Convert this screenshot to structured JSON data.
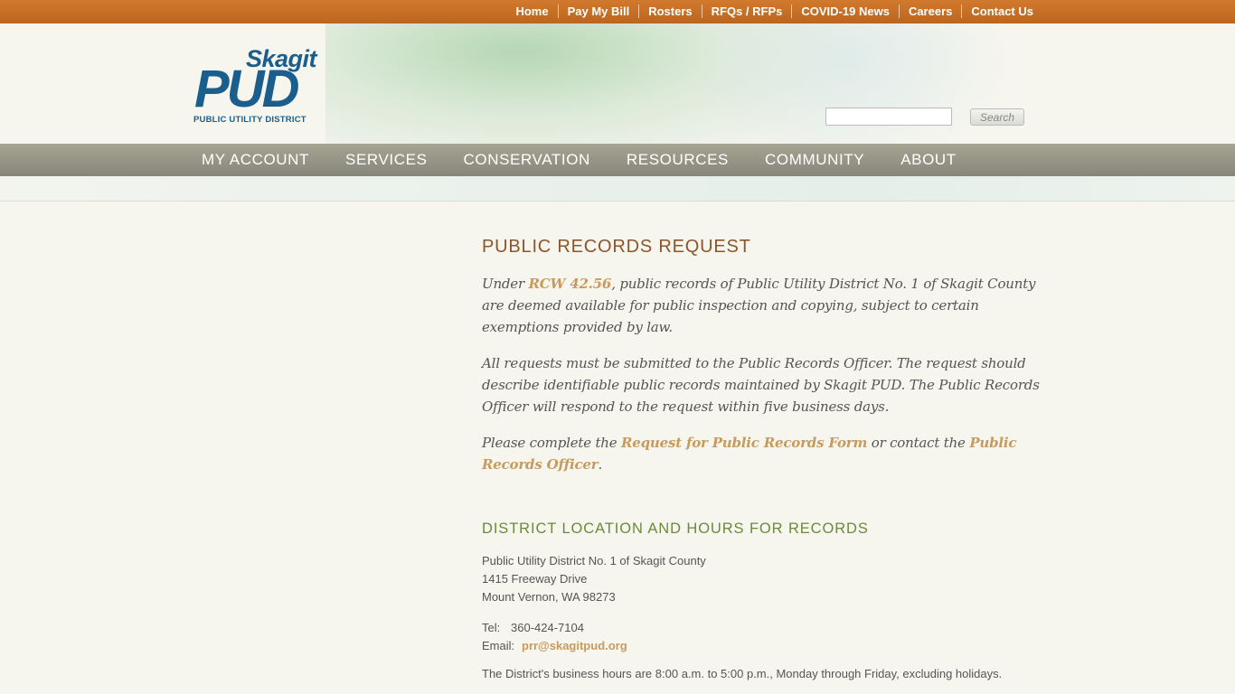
{
  "top_nav": [
    "Home",
    "Pay My Bill",
    "Rosters",
    "RFQs / RFPs",
    "COVID-19 News",
    "Careers",
    "Contact Us"
  ],
  "logo": {
    "word1": "Skagit",
    "word2": "PUD",
    "tagline": "PUBLIC UTILITY DISTRICT"
  },
  "search": {
    "value": "",
    "button": "Search"
  },
  "main_nav": [
    "MY ACCOUNT",
    "SERVICES",
    "CONSERVATION",
    "RESOURCES",
    "COMMUNITY",
    "ABOUT"
  ],
  "content": {
    "title": "PUBLIC RECORDS REQUEST",
    "p1": {
      "before": "Under ",
      "link": "RCW 42.56",
      "after": ", public records of Public Utility District No. 1 of Skagit County are deemed available for public inspection and copying, subject to certain exemptions provided by law."
    },
    "p2": "All requests must be submitted to the Public Records Officer.  The request should describe identifiable public records maintained by Skagit PUD.  The Public Records Officer will respond to the request within five business days.",
    "p3": {
      "before": "Please complete the ",
      "link1": "Request for Public Records Form",
      "middle": " or contact the ",
      "link2": "Public Records Officer",
      "after": "."
    },
    "location_title": "DISTRICT LOCATION AND HOURS FOR RECORDS",
    "address": [
      "Public Utility District No. 1 of Skagit County",
      "1415 Freeway Drive",
      "Mount Vernon, WA 98273"
    ],
    "tel_label": "Tel:",
    "tel": "360-424-7104",
    "email_label": "Email:",
    "email": "prr@skagitpud.org",
    "hours": "The District's business hours are 8:00 a.m. to 5:00 p.m., Monday through Friday, excluding holidays."
  },
  "colors": {
    "topbar": "#c46d25",
    "nav": "#96958a",
    "title": "#8e552a",
    "subtitle": "#6b8a3c",
    "link": "#c89a5c",
    "logo": "#1a5e8e"
  }
}
